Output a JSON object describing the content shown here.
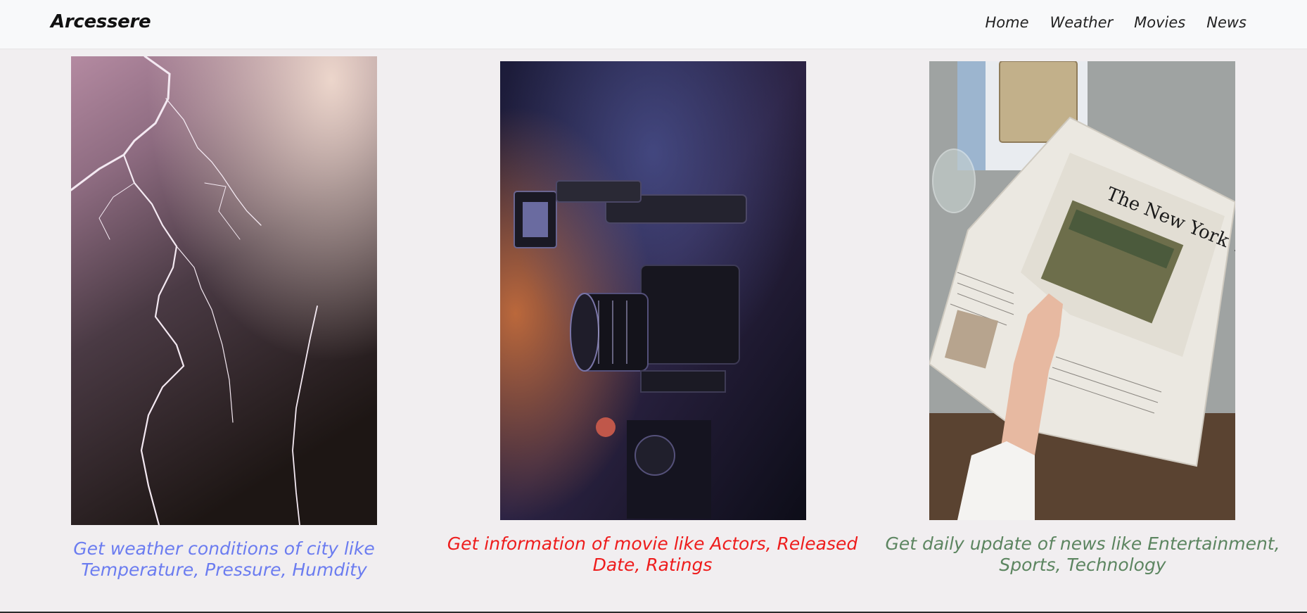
{
  "brand": {
    "name": "Arcessere"
  },
  "nav": {
    "items": [
      {
        "label": "Home"
      },
      {
        "label": "Weather"
      },
      {
        "label": "Movies"
      },
      {
        "label": "News"
      }
    ]
  },
  "cards": [
    {
      "image": "lightning-storm-photo",
      "caption": "Get weather conditions of city like Temperature, Pressure, Humdity",
      "caption_color": "#6b7cf0"
    },
    {
      "image": "cinema-camera-photo",
      "caption": "Get information of movie like Actors, Released Date, Ratings",
      "caption_color": "#ee1c1c"
    },
    {
      "image": "newspaper-on-table-photo",
      "caption": "Get daily update of news like Entertainment, Sports, Technology",
      "caption_color": "#5c8560"
    }
  ]
}
